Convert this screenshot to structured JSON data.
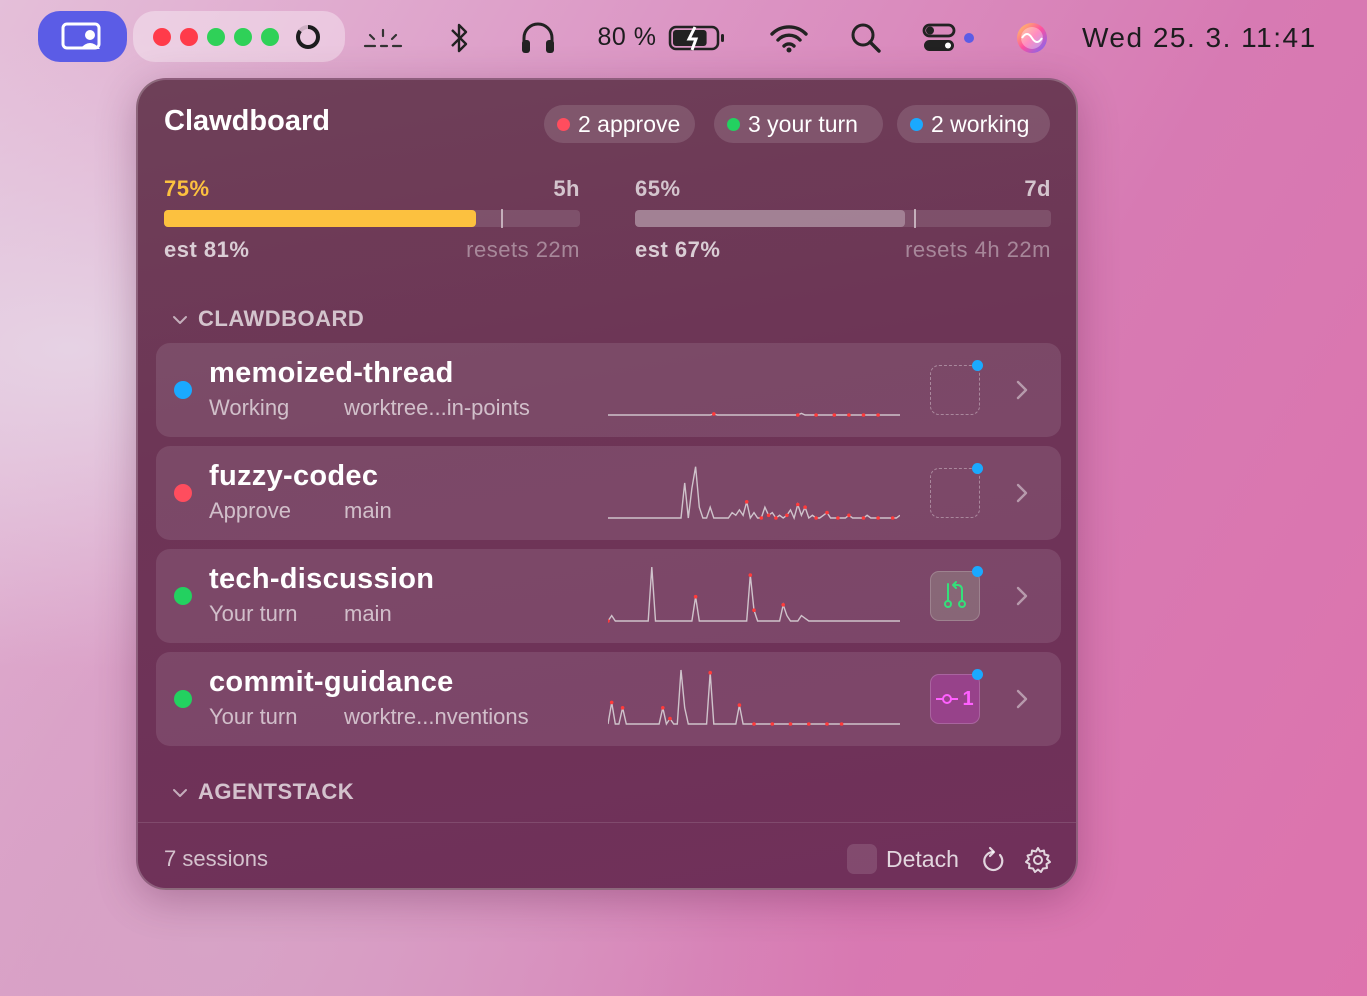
{
  "colors": {
    "accent": "#5b5ce6",
    "red": "#ff4d5e",
    "green": "#23d160",
    "blue": "#1aa9ff",
    "usage_bar": "#fcc13f",
    "spark_line": "#cfc3cb",
    "spark_marker": "#ff3b3b"
  },
  "menubar": {
    "app_icon": "person-screen-icon",
    "traffic_dots": [
      "#ff3b4a",
      "#ff3b4a",
      "#2fd158",
      "#2fd158",
      "#2fd158"
    ],
    "progress_ring": {
      "icon": "progress-ring-icon",
      "value": 0.85
    },
    "items": [
      "weather-icon",
      "bluetooth-icon",
      "headphones-icon"
    ],
    "battery_text": "80 %",
    "battery_icon": "battery-charging-icon",
    "battery_level": 0.8,
    "wifi_icon": "wifi-icon",
    "search_icon": "search-icon",
    "control_center_icon": "control-center-icon",
    "siri_icon": "siri-icon",
    "clock": "Wed 25. 3.  11:41"
  },
  "panel": {
    "title": "Clawdboard",
    "badges": [
      {
        "label": "2 approve",
        "color": "#ff4d5e"
      },
      {
        "label": "3 your turn",
        "color": "#23d160"
      },
      {
        "label": "2 working",
        "color": "#1aa9ff"
      }
    ],
    "usage": [
      {
        "pct": "75%",
        "window": "5h",
        "est": "est 81%",
        "resets": "resets 22m",
        "fill": 0.75,
        "est_mark": 0.81,
        "color": "#fcc13f",
        "pct_color": "#fcc13f"
      },
      {
        "pct": "65%",
        "window": "7d",
        "est": "est 67%",
        "resets": "resets 4h 22m",
        "fill": 0.65,
        "est_mark": 0.67,
        "color": "rgba(255,255,255,0.28)",
        "pct_color": "rgba(255,255,255,0.7)"
      }
    ],
    "sections": [
      {
        "title": "CLAWDBOARD",
        "sessions": [
          {
            "name": "memoized-thread",
            "state": "Working",
            "branch": "worktree...in-points",
            "status_color": "#1aa9ff",
            "chip": "empty",
            "activity": [
              0,
              0,
              0,
              0,
              0,
              0,
              0,
              0,
              0,
              0,
              0,
              0,
              0,
              0,
              0,
              0,
              0,
              0,
              0,
              0,
              0,
              0,
              0,
              0,
              0,
              0,
              0,
              0,
              0,
              0.02,
              0,
              0,
              0,
              0,
              0,
              0,
              0,
              0,
              0,
              0,
              0,
              0,
              0,
              0,
              0,
              0,
              0,
              0,
              0,
              0,
              0,
              0,
              0,
              0.03,
              0,
              0,
              0,
              0,
              0,
              0,
              0,
              0,
              0,
              0,
              0,
              0,
              0,
              0,
              0,
              0,
              0,
              0,
              0,
              0,
              0,
              0,
              0,
              0,
              0,
              0,
              0
            ],
            "markers": [
              29,
              52,
              57,
              62,
              66,
              70,
              74
            ]
          },
          {
            "name": "fuzzy-codec",
            "state": "Approve",
            "branch": "main",
            "status_color": "#ff4d5e",
            "chip": "empty",
            "activity": [
              0,
              0,
              0,
              0,
              0,
              0,
              0,
              0,
              0,
              0,
              0,
              0,
              0,
              0,
              0,
              0,
              0,
              0,
              0,
              0,
              0,
              0.65,
              0,
              0.55,
              0.95,
              0.2,
              0,
              0,
              0.2,
              0,
              0,
              0,
              0,
              0,
              0.1,
              0.05,
              0.15,
              0.05,
              0.3,
              0,
              0.1,
              0,
              0,
              0.2,
              0.05,
              0.1,
              0,
              0.05,
              0,
              0.05,
              0.15,
              0,
              0.25,
              0.05,
              0.2,
              0,
              0.05,
              0,
              0,
              0.05,
              0.1,
              0,
              0,
              0,
              0,
              0,
              0.05,
              0,
              0,
              0,
              0,
              0.05,
              0,
              0,
              0,
              0,
              0,
              0,
              0,
              0,
              0.05
            ],
            "markers": [
              38,
              42,
              44,
              46,
              49,
              52,
              54,
              57,
              60,
              63,
              66,
              70,
              74,
              78
            ]
          },
          {
            "name": "tech-discussion",
            "state": "Your turn",
            "branch": "main",
            "status_color": "#23d160",
            "chip": "pr",
            "activity": [
              0,
              0.1,
              0,
              0,
              0,
              0,
              0,
              0,
              0,
              0,
              0,
              0,
              1,
              0,
              0,
              0,
              0,
              0,
              0,
              0,
              0,
              0,
              0,
              0,
              0.45,
              0,
              0,
              0,
              0,
              0,
              0,
              0,
              0,
              0,
              0,
              0,
              0,
              0,
              0,
              0.85,
              0.2,
              0,
              0,
              0,
              0,
              0,
              0,
              0,
              0.3,
              0.1,
              0,
              0,
              0,
              0.1,
              0.05,
              0,
              0,
              0,
              0,
              0,
              0,
              0,
              0,
              0,
              0,
              0,
              0,
              0,
              0,
              0,
              0,
              0,
              0,
              0,
              0,
              0,
              0,
              0,
              0,
              0,
              0
            ],
            "markers": [
              0,
              24,
              39,
              40,
              48
            ]
          },
          {
            "name": "commit-guidance",
            "state": "Your turn",
            "branch": "worktre...nventions",
            "status_color": "#23d160",
            "chip": "commit",
            "chip_label": "1",
            "activity": [
              0,
              0.4,
              0,
              0,
              0.3,
              0,
              0,
              0,
              0,
              0,
              0,
              0,
              0,
              0,
              0,
              0.3,
              0,
              0.1,
              0,
              0,
              1,
              0.3,
              0,
              0,
              0,
              0,
              0,
              0,
              0.95,
              0,
              0,
              0,
              0,
              0,
              0,
              0,
              0.35,
              0,
              0,
              0,
              0,
              0,
              0,
              0,
              0,
              0,
              0,
              0,
              0,
              0,
              0,
              0,
              0,
              0,
              0,
              0,
              0,
              0,
              0,
              0,
              0,
              0,
              0,
              0,
              0,
              0,
              0,
              0,
              0,
              0,
              0,
              0,
              0,
              0,
              0,
              0,
              0,
              0,
              0,
              0,
              0
            ],
            "markers": [
              1,
              4,
              15,
              17,
              28,
              36,
              40,
              45,
              50,
              55,
              60,
              64
            ]
          }
        ]
      },
      {
        "title": "AGENTSTACK",
        "sessions": []
      }
    ],
    "footer": {
      "sessions": "7 sessions",
      "detach_label": "Detach",
      "refresh_icon": "refresh-icon",
      "settings_icon": "gear-icon"
    }
  }
}
